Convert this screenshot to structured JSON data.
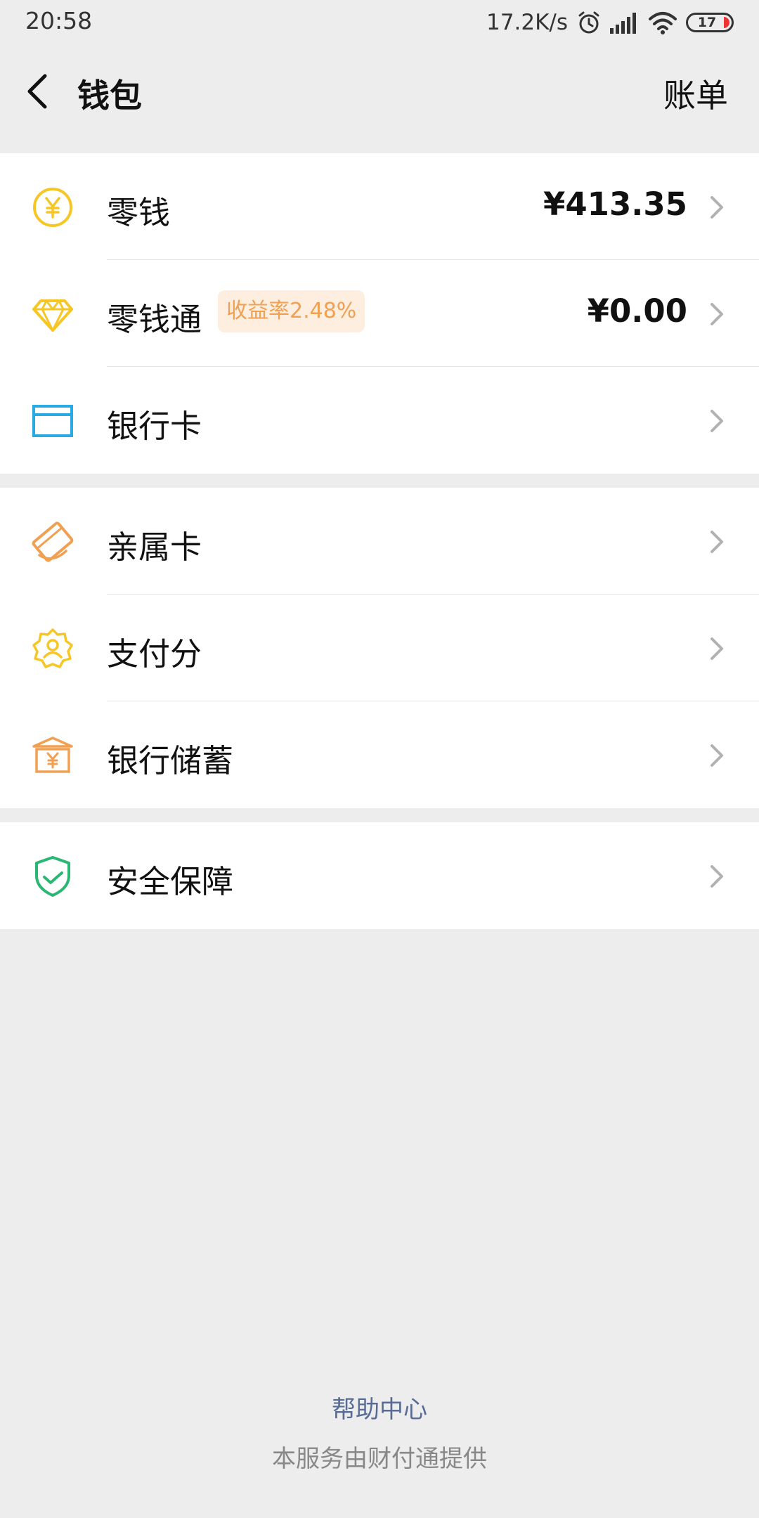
{
  "status_bar": {
    "time": "20:58",
    "net_speed": "17.2K/s",
    "battery": "17",
    "icons": [
      "alarm-icon",
      "signal-icon",
      "wifi-icon",
      "battery-icon"
    ]
  },
  "header": {
    "title": "钱包",
    "action_label": "账单",
    "back_icon": "back-arrow-icon"
  },
  "sections": [
    {
      "items": [
        {
          "label": "零钱",
          "value": "¥413.35",
          "icon": "yuan-coin-icon",
          "icon_color": "#f6c625"
        },
        {
          "label": "零钱通",
          "value": "¥0.00",
          "badge": "收益率2.48%",
          "icon": "diamond-icon",
          "icon_color": "#f6c625"
        },
        {
          "label": "银行卡",
          "value": "",
          "icon": "bank-card-icon",
          "icon_color": "#2aaae2"
        }
      ]
    },
    {
      "items": [
        {
          "label": "亲属卡",
          "icon": "family-card-icon",
          "icon_color": "#f0a050"
        },
        {
          "label": "支付分",
          "icon": "pay-score-icon",
          "icon_color": "#f6c625"
        },
        {
          "label": "银行储蓄",
          "icon": "bank-savings-icon",
          "icon_color": "#f0a050"
        }
      ]
    },
    {
      "items": [
        {
          "label": "安全保障",
          "icon": "security-shield-icon",
          "icon_color": "#2ab673"
        }
      ]
    }
  ],
  "footer": {
    "help_link": "帮助中心",
    "provider_note": "本服务由财付通提供"
  },
  "colors": {
    "background": "#ededed",
    "link": "#576b95",
    "badge_bg": "#fdeee0",
    "badge_text": "#f0a050"
  }
}
